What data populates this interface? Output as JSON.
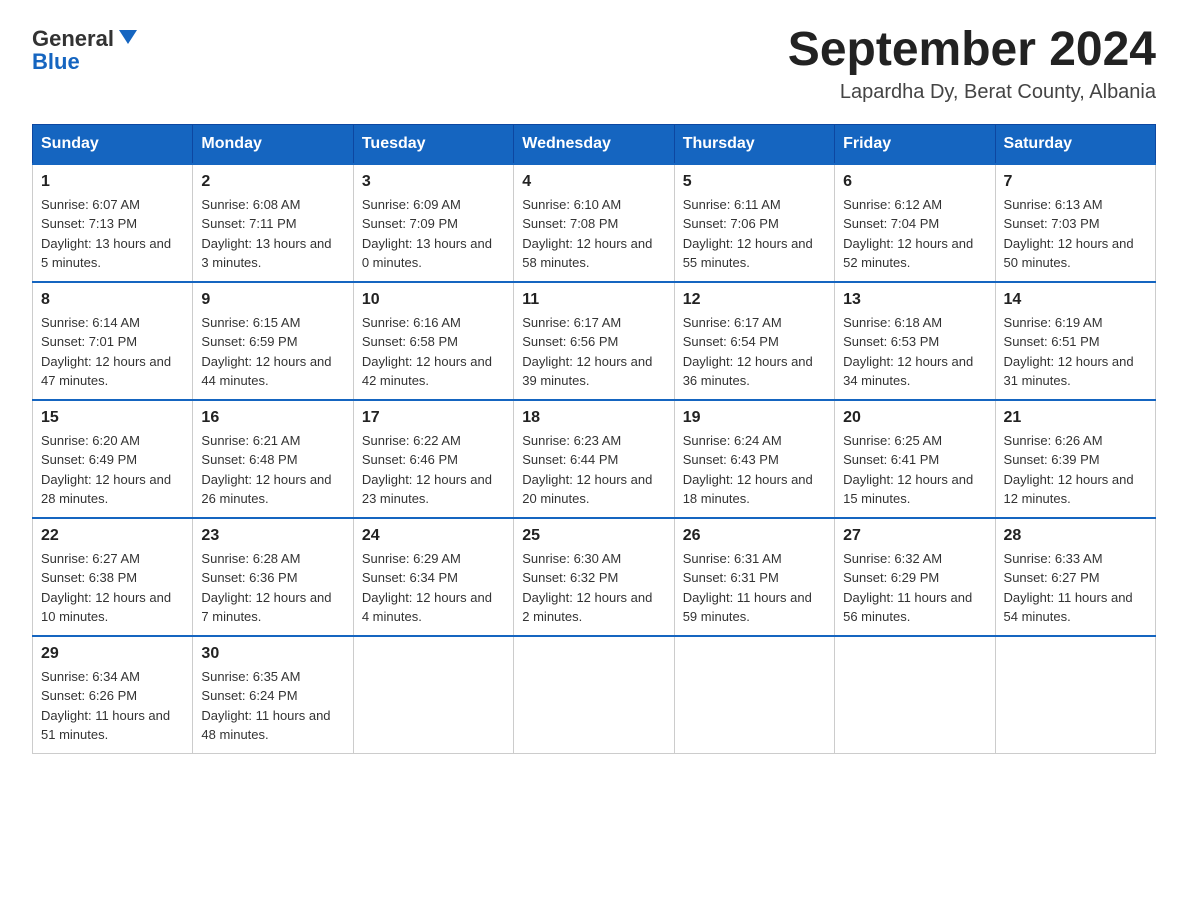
{
  "logo": {
    "text_general": "General",
    "text_blue": "Blue"
  },
  "header": {
    "month_year": "September 2024",
    "location": "Lapardha Dy, Berat County, Albania"
  },
  "days_of_week": [
    "Sunday",
    "Monday",
    "Tuesday",
    "Wednesday",
    "Thursday",
    "Friday",
    "Saturday"
  ],
  "weeks": [
    [
      {
        "day": "1",
        "sunrise": "6:07 AM",
        "sunset": "7:13 PM",
        "daylight": "13 hours and 5 minutes."
      },
      {
        "day": "2",
        "sunrise": "6:08 AM",
        "sunset": "7:11 PM",
        "daylight": "13 hours and 3 minutes."
      },
      {
        "day": "3",
        "sunrise": "6:09 AM",
        "sunset": "7:09 PM",
        "daylight": "13 hours and 0 minutes."
      },
      {
        "day": "4",
        "sunrise": "6:10 AM",
        "sunset": "7:08 PM",
        "daylight": "12 hours and 58 minutes."
      },
      {
        "day": "5",
        "sunrise": "6:11 AM",
        "sunset": "7:06 PM",
        "daylight": "12 hours and 55 minutes."
      },
      {
        "day": "6",
        "sunrise": "6:12 AM",
        "sunset": "7:04 PM",
        "daylight": "12 hours and 52 minutes."
      },
      {
        "day": "7",
        "sunrise": "6:13 AM",
        "sunset": "7:03 PM",
        "daylight": "12 hours and 50 minutes."
      }
    ],
    [
      {
        "day": "8",
        "sunrise": "6:14 AM",
        "sunset": "7:01 PM",
        "daylight": "12 hours and 47 minutes."
      },
      {
        "day": "9",
        "sunrise": "6:15 AM",
        "sunset": "6:59 PM",
        "daylight": "12 hours and 44 minutes."
      },
      {
        "day": "10",
        "sunrise": "6:16 AM",
        "sunset": "6:58 PM",
        "daylight": "12 hours and 42 minutes."
      },
      {
        "day": "11",
        "sunrise": "6:17 AM",
        "sunset": "6:56 PM",
        "daylight": "12 hours and 39 minutes."
      },
      {
        "day": "12",
        "sunrise": "6:17 AM",
        "sunset": "6:54 PM",
        "daylight": "12 hours and 36 minutes."
      },
      {
        "day": "13",
        "sunrise": "6:18 AM",
        "sunset": "6:53 PM",
        "daylight": "12 hours and 34 minutes."
      },
      {
        "day": "14",
        "sunrise": "6:19 AM",
        "sunset": "6:51 PM",
        "daylight": "12 hours and 31 minutes."
      }
    ],
    [
      {
        "day": "15",
        "sunrise": "6:20 AM",
        "sunset": "6:49 PM",
        "daylight": "12 hours and 28 minutes."
      },
      {
        "day": "16",
        "sunrise": "6:21 AM",
        "sunset": "6:48 PM",
        "daylight": "12 hours and 26 minutes."
      },
      {
        "day": "17",
        "sunrise": "6:22 AM",
        "sunset": "6:46 PM",
        "daylight": "12 hours and 23 minutes."
      },
      {
        "day": "18",
        "sunrise": "6:23 AM",
        "sunset": "6:44 PM",
        "daylight": "12 hours and 20 minutes."
      },
      {
        "day": "19",
        "sunrise": "6:24 AM",
        "sunset": "6:43 PM",
        "daylight": "12 hours and 18 minutes."
      },
      {
        "day": "20",
        "sunrise": "6:25 AM",
        "sunset": "6:41 PM",
        "daylight": "12 hours and 15 minutes."
      },
      {
        "day": "21",
        "sunrise": "6:26 AM",
        "sunset": "6:39 PM",
        "daylight": "12 hours and 12 minutes."
      }
    ],
    [
      {
        "day": "22",
        "sunrise": "6:27 AM",
        "sunset": "6:38 PM",
        "daylight": "12 hours and 10 minutes."
      },
      {
        "day": "23",
        "sunrise": "6:28 AM",
        "sunset": "6:36 PM",
        "daylight": "12 hours and 7 minutes."
      },
      {
        "day": "24",
        "sunrise": "6:29 AM",
        "sunset": "6:34 PM",
        "daylight": "12 hours and 4 minutes."
      },
      {
        "day": "25",
        "sunrise": "6:30 AM",
        "sunset": "6:32 PM",
        "daylight": "12 hours and 2 minutes."
      },
      {
        "day": "26",
        "sunrise": "6:31 AM",
        "sunset": "6:31 PM",
        "daylight": "11 hours and 59 minutes."
      },
      {
        "day": "27",
        "sunrise": "6:32 AM",
        "sunset": "6:29 PM",
        "daylight": "11 hours and 56 minutes."
      },
      {
        "day": "28",
        "sunrise": "6:33 AM",
        "sunset": "6:27 PM",
        "daylight": "11 hours and 54 minutes."
      }
    ],
    [
      {
        "day": "29",
        "sunrise": "6:34 AM",
        "sunset": "6:26 PM",
        "daylight": "11 hours and 51 minutes."
      },
      {
        "day": "30",
        "sunrise": "6:35 AM",
        "sunset": "6:24 PM",
        "daylight": "11 hours and 48 minutes."
      },
      null,
      null,
      null,
      null,
      null
    ]
  ],
  "labels": {
    "sunrise": "Sunrise:",
    "sunset": "Sunset:",
    "daylight": "Daylight:"
  }
}
